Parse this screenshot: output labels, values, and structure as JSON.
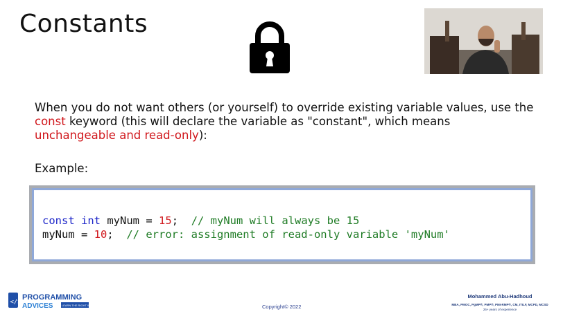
{
  "slide": {
    "title": "Constants",
    "desc_part1": "When you do not want others (or yourself) to override existing variable values, use the ",
    "desc_kw": "const",
    "desc_part2": " keyword (this will declare the variable as \"constant\", which means ",
    "desc_red": "unchangeable and read-only",
    "desc_part3": "):",
    "example_label": "Example:"
  },
  "code": {
    "line1": {
      "kw1": "const",
      "kw2": "int",
      "mid": " myNum = ",
      "num": "15",
      "end": ";  ",
      "comment": "// myNum will always be 15"
    },
    "line2": {
      "start": "myNum = ",
      "num": "10",
      "end": ";  ",
      "comment": "// error: assignment of read-only variable 'myNum'"
    }
  },
  "footer": {
    "logo_line1": "PROGRAMMING",
    "logo_line2": "ADVICES",
    "logo_tag": "LEARN THE RIGHT WAY",
    "copyright": "Copyright© 2022",
    "presenter_name": "Mohammed Abu-Hadhoud",
    "presenter_creds": "MBA, PMOC, PgMP®, PMP®, PMI-RMP®, CM, ITILF, MCPD, MCSD",
    "presenter_years": "26+ years of experience"
  },
  "icons": {
    "lock": "lock-icon",
    "logo": "programming-advices-logo"
  },
  "colors": {
    "keyword": "#1d26c9",
    "number": "#d0161b",
    "comment": "#1e7b24",
    "highlight": "#d0161b"
  }
}
